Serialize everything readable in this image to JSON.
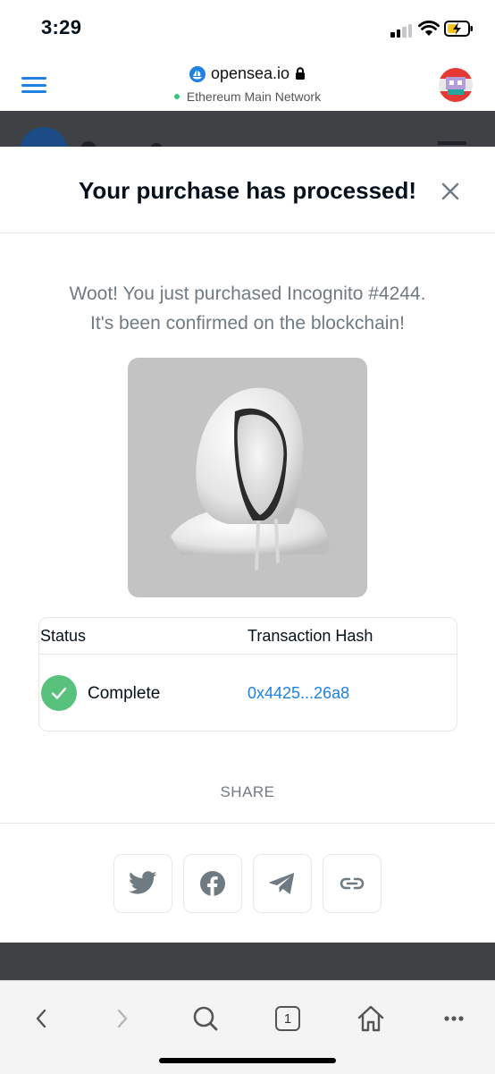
{
  "status_bar": {
    "time": "3:29"
  },
  "browser": {
    "domain": "opensea.io",
    "network": "Ethereum Main Network"
  },
  "modal": {
    "title": "Your purchase has processed!",
    "message_line1": "Woot! You just purchased Incognito #4244.",
    "message_line2": "It's been confirmed on the blockchain!",
    "table": {
      "status_header": "Status",
      "hash_header": "Transaction Hash",
      "status_value": "Complete",
      "hash_value": "0x4425...26a8"
    },
    "share_label": "SHARE",
    "share_buttons": [
      "twitter-icon",
      "facebook-icon",
      "telegram-icon",
      "link-icon"
    ]
  },
  "toolbar": {
    "tab_count": "1",
    "icons": [
      "back-icon",
      "forward-icon",
      "search-icon",
      "tabs-icon",
      "home-icon",
      "more-icon"
    ]
  },
  "colors": {
    "accent": "#2081e2",
    "success": "#58c27d",
    "muted_text": "#707a83",
    "overlay": "#3f4144"
  }
}
